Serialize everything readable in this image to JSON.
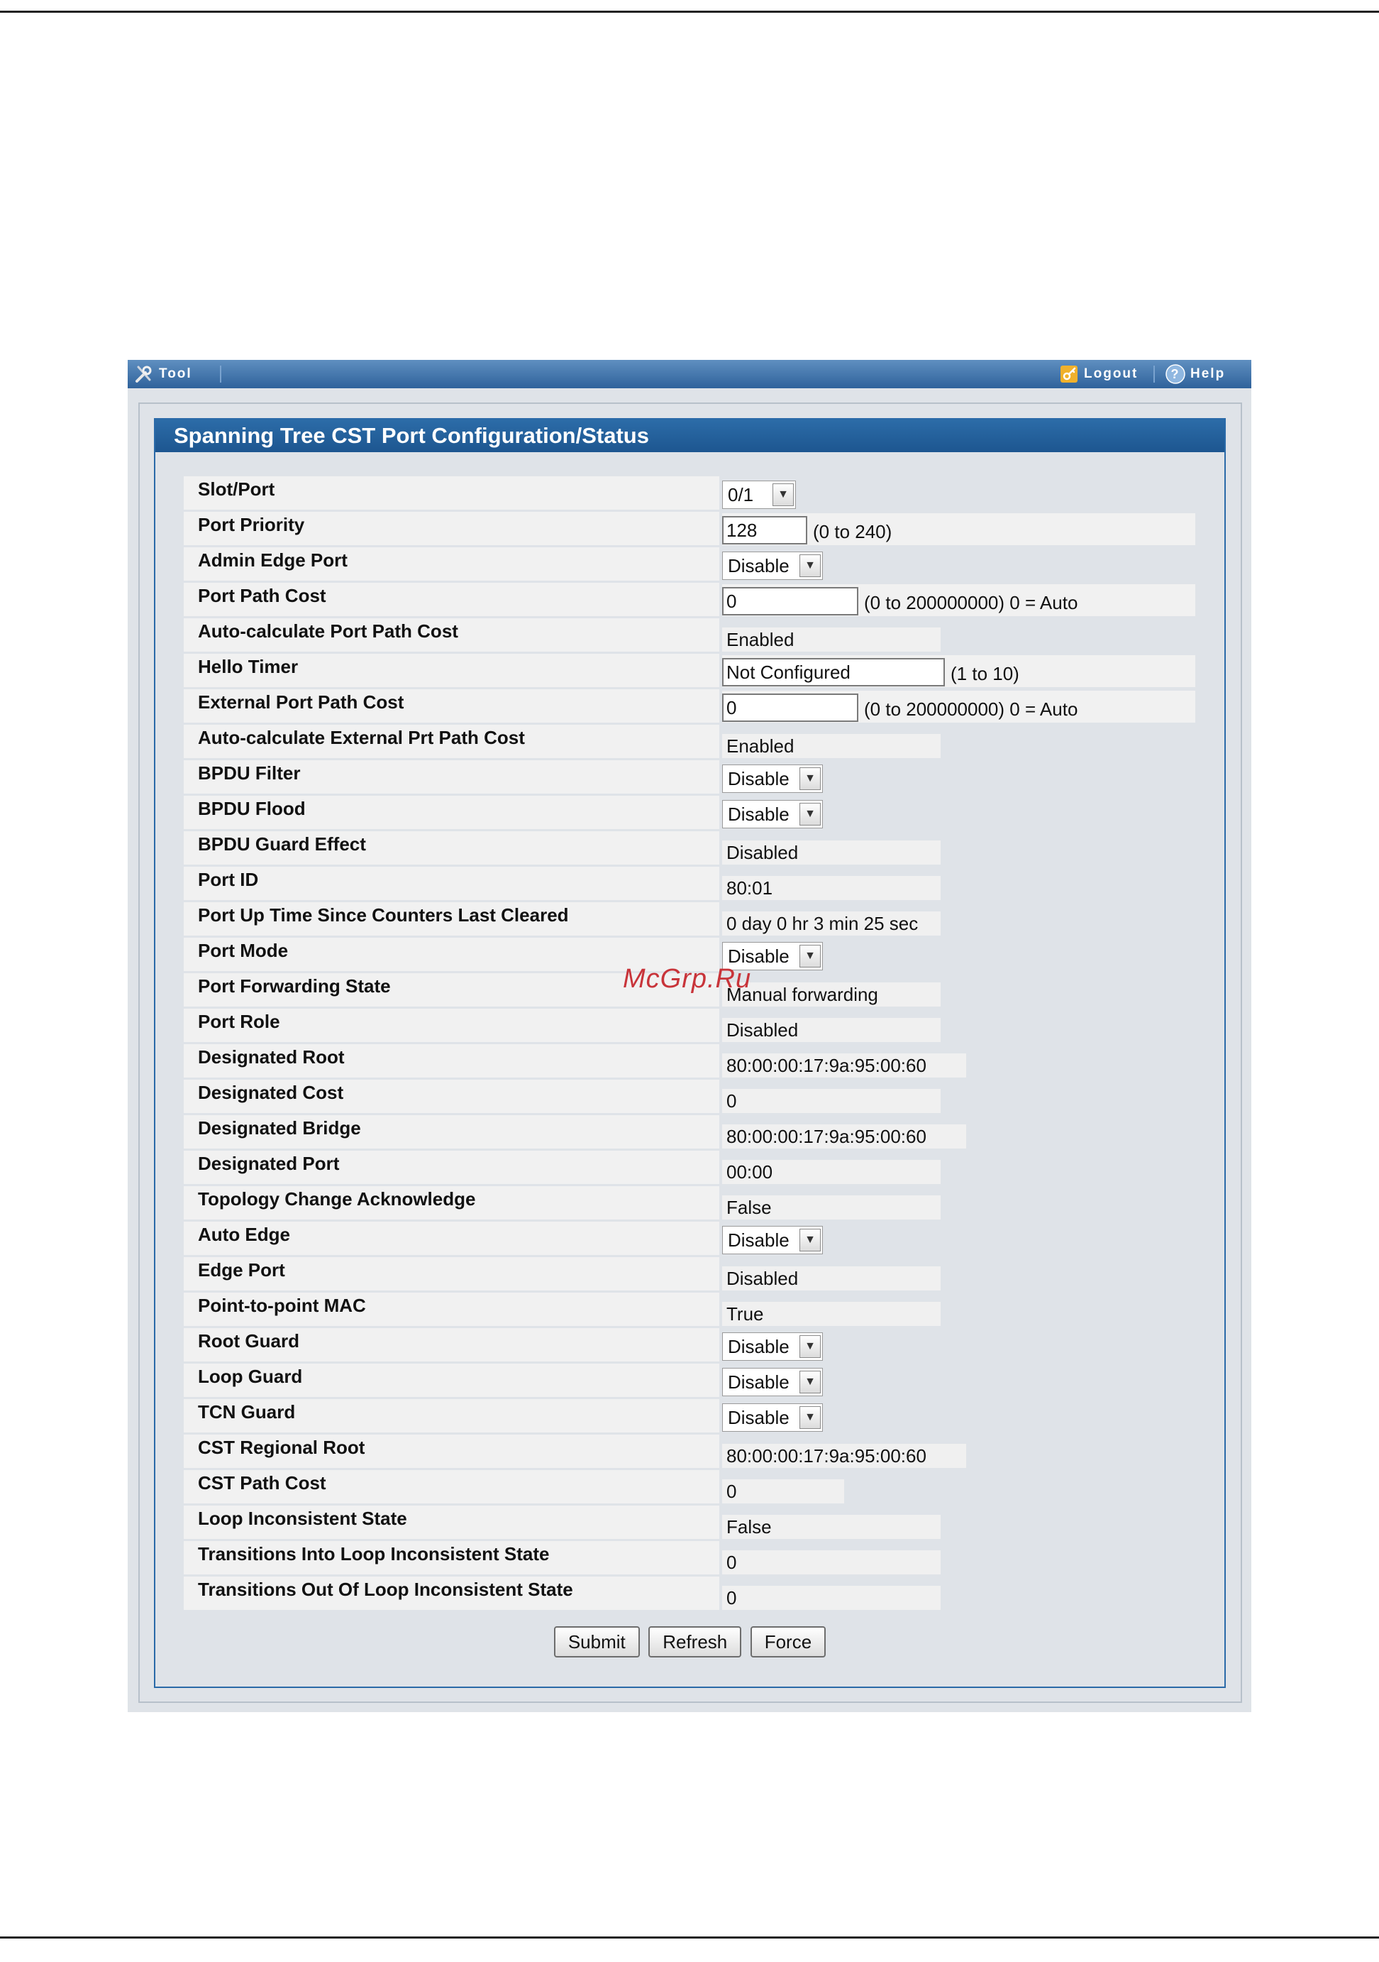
{
  "toolbar": {
    "tool_label": "Tool",
    "logout_label": "Logout",
    "help_label": "Help",
    "tool_icon": "wrench-icon",
    "logout_icon": "key-icon",
    "help_icon": "help-icon"
  },
  "panel": {
    "title": "Spanning Tree CST Port Configuration/Status"
  },
  "fields": {
    "slot_port": {
      "label": "Slot/Port",
      "value": "0/1"
    },
    "port_priority": {
      "label": "Port Priority",
      "value": "128",
      "hint": "(0 to 240)"
    },
    "admin_edge_port": {
      "label": "Admin Edge Port",
      "value": "Disable"
    },
    "port_path_cost": {
      "label": "Port Path Cost",
      "value": "0",
      "hint": "(0 to 200000000) 0 = Auto"
    },
    "auto_port_path_cost": {
      "label": "Auto-calculate Port Path Cost",
      "value": "Enabled"
    },
    "hello_timer": {
      "label": "Hello Timer",
      "value": "Not Configured",
      "hint": "(1 to 10)"
    },
    "ext_port_path_cost": {
      "label": "External Port Path Cost",
      "value": "0",
      "hint": "(0 to 200000000) 0 = Auto"
    },
    "auto_ext_path_cost": {
      "label": "Auto-calculate External Prt Path Cost",
      "value": "Enabled"
    },
    "bpdu_filter": {
      "label": "BPDU Filter",
      "value": "Disable"
    },
    "bpdu_flood": {
      "label": "BPDU Flood",
      "value": "Disable"
    },
    "bpdu_guard_effect": {
      "label": "BPDU Guard Effect",
      "value": "Disabled"
    },
    "port_id": {
      "label": "Port ID",
      "value": "80:01"
    },
    "port_up_time": {
      "label": "Port Up Time Since Counters Last Cleared",
      "value": "0 day 0 hr 3 min 25 sec"
    },
    "port_mode": {
      "label": "Port Mode",
      "value": "Disable"
    },
    "port_forwarding_state": {
      "label": "Port Forwarding State",
      "value": "Manual forwarding"
    },
    "port_role": {
      "label": "Port Role",
      "value": "Disabled"
    },
    "designated_root": {
      "label": "Designated Root",
      "value": "80:00:00:17:9a:95:00:60"
    },
    "designated_cost": {
      "label": "Designated Cost",
      "value": "0"
    },
    "designated_bridge": {
      "label": "Designated Bridge",
      "value": "80:00:00:17:9a:95:00:60"
    },
    "designated_port": {
      "label": "Designated Port",
      "value": "00:00"
    },
    "topology_change_ack": {
      "label": "Topology Change Acknowledge",
      "value": "False"
    },
    "auto_edge": {
      "label": "Auto Edge",
      "value": "Disable"
    },
    "edge_port": {
      "label": "Edge Port",
      "value": "Disabled"
    },
    "p2p_mac": {
      "label": "Point-to-point MAC",
      "value": "True"
    },
    "root_guard": {
      "label": "Root Guard",
      "value": "Disable"
    },
    "loop_guard": {
      "label": "Loop Guard",
      "value": "Disable"
    },
    "tcn_guard": {
      "label": "TCN Guard",
      "value": "Disable"
    },
    "cst_regional_root": {
      "label": "CST Regional Root",
      "value": "80:00:00:17:9a:95:00:60"
    },
    "cst_path_cost": {
      "label": "CST Path Cost",
      "value": "0"
    },
    "loop_inconsistent_state": {
      "label": "Loop Inconsistent State",
      "value": "False"
    },
    "transitions_into": {
      "label": "Transitions Into Loop Inconsistent State",
      "value": "0"
    },
    "transitions_out": {
      "label": "Transitions Out Of Loop Inconsistent State",
      "value": "0"
    }
  },
  "buttons": {
    "submit": "Submit",
    "refresh": "Refresh",
    "force": "Force"
  },
  "watermark": "McGrp.Ru",
  "colors": {
    "toolbar": "#2f629b",
    "panel_title": "#1d5690",
    "watermark": "#c8343a"
  }
}
